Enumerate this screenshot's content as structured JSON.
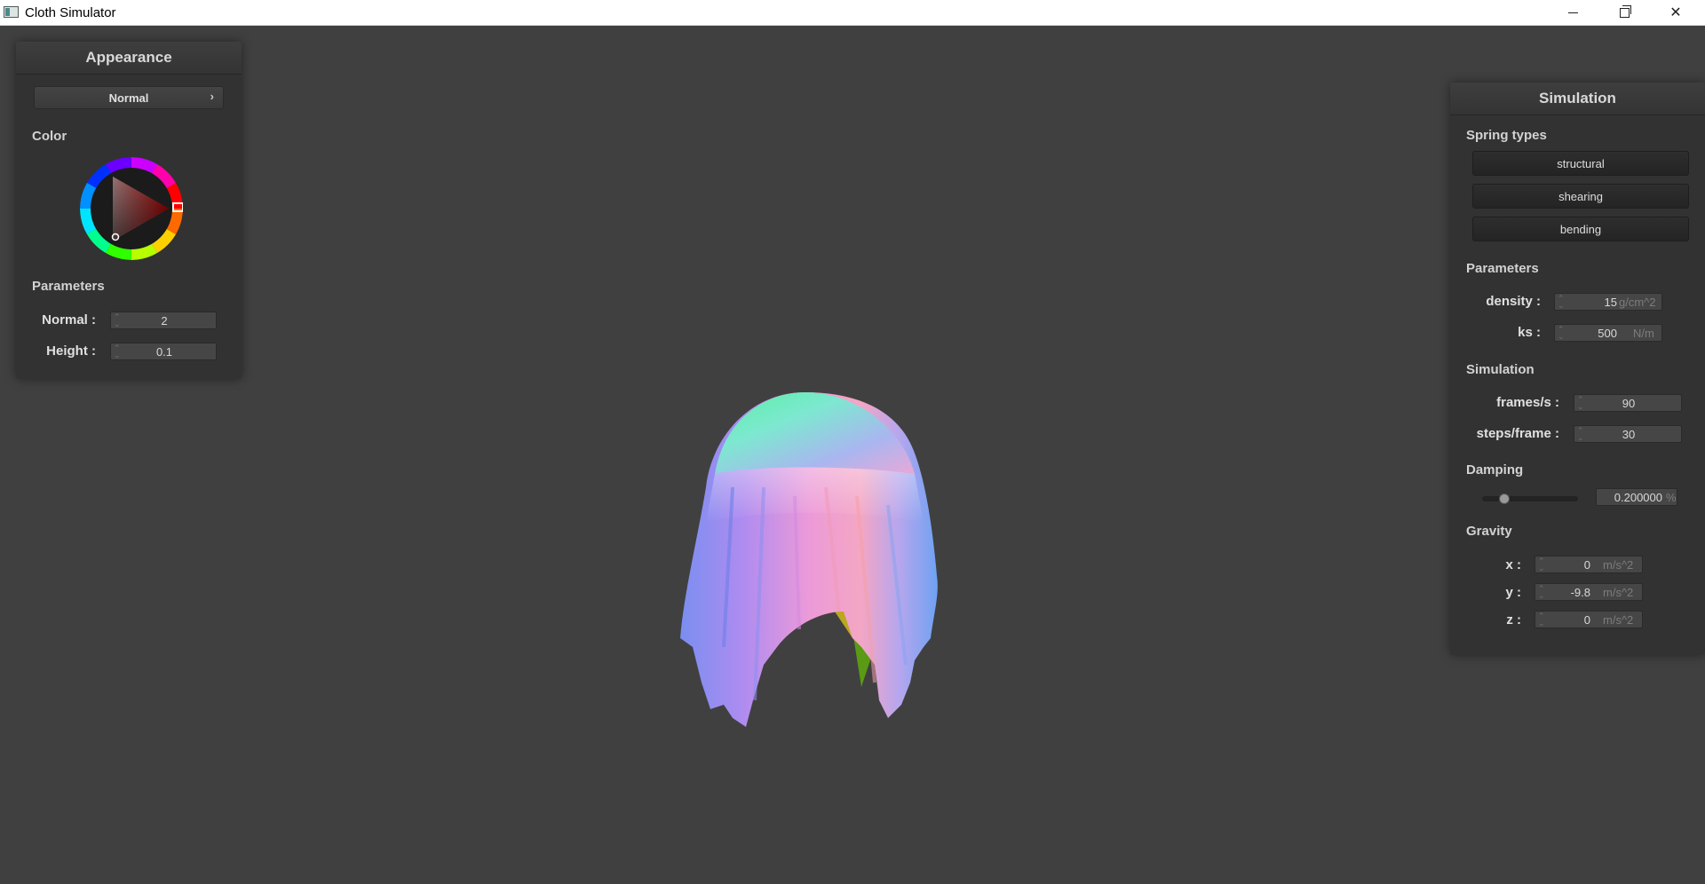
{
  "window": {
    "title": "Cloth Simulator"
  },
  "appearance": {
    "title": "Appearance",
    "shader_select": {
      "value": "Normal"
    },
    "color_label": "Color",
    "parameters_label": "Parameters",
    "normal": {
      "label": "Normal :",
      "value": "2"
    },
    "height": {
      "label": "Height :",
      "value": "0.1"
    },
    "picked_color": "#ff0000"
  },
  "simulation": {
    "title": "Simulation",
    "spring_types_label": "Spring types",
    "spring_buttons": [
      "structural",
      "shearing",
      "bending"
    ],
    "parameters_label": "Parameters",
    "density": {
      "label": "density :",
      "value": "15",
      "unit": "g/cm^2"
    },
    "ks": {
      "label": "ks :",
      "value": "500",
      "unit": "N/m"
    },
    "sim_label": "Simulation",
    "fps": {
      "label": "frames/s :",
      "value": "90"
    },
    "steps": {
      "label": "steps/frame :",
      "value": "30"
    },
    "damping_label": "Damping",
    "damping": {
      "value": "0.200000",
      "unit": "%",
      "fraction": 0.2
    },
    "gravity_label": "Gravity",
    "gx": {
      "label": "x :",
      "value": "0",
      "unit": "m/s^2"
    },
    "gy": {
      "label": "y :",
      "value": "-9.8",
      "unit": "m/s^2"
    },
    "gz": {
      "label": "z :",
      "value": "0",
      "unit": "m/s^2"
    }
  }
}
